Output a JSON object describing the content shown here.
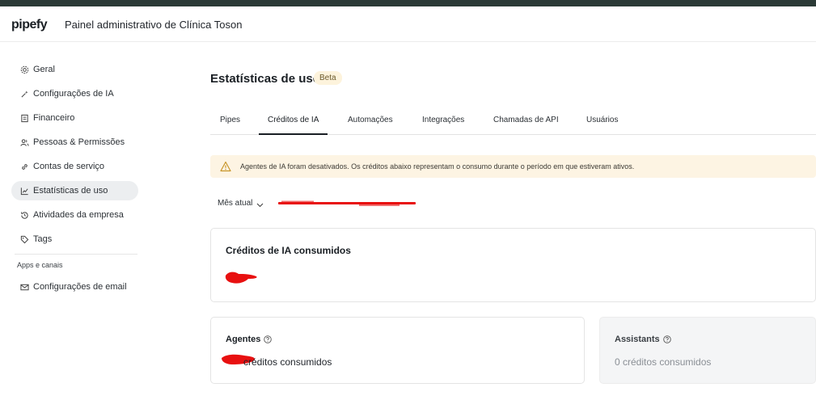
{
  "app": {
    "logo": "pipefy",
    "title": "Painel administrativo de Clínica Toson"
  },
  "sidebar": {
    "items": [
      {
        "label": "Geral",
        "icon": "gear-icon"
      },
      {
        "label": "Configurações de IA",
        "icon": "sparkle-icon"
      },
      {
        "label": "Financeiro",
        "icon": "invoice-icon"
      },
      {
        "label": "Pessoas & Permissões",
        "icon": "people-icon"
      },
      {
        "label": "Contas de serviço",
        "icon": "link-icon"
      },
      {
        "label": "Estatísticas de uso",
        "icon": "chart-icon",
        "active": true
      },
      {
        "label": "Atividades da empresa",
        "icon": "history-icon"
      },
      {
        "label": "Tags",
        "icon": "tag-icon"
      }
    ],
    "section_title": "Apps e canais",
    "section_items": [
      {
        "label": "Configurações de email",
        "icon": "mail-icon"
      }
    ]
  },
  "page": {
    "title": "Estatísticas de uso",
    "badge": "Beta"
  },
  "tabs": [
    {
      "label": "Pipes"
    },
    {
      "label": "Créditos de IA",
      "active": true
    },
    {
      "label": "Automações"
    },
    {
      "label": "Integrações"
    },
    {
      "label": "Chamadas de API"
    },
    {
      "label": "Usuários"
    }
  ],
  "alert": {
    "text": "Agentes de IA foram desativados. Os créditos abaixo representam o consumo durante o período em que estiveram ativos.",
    "icon": "warning-icon"
  },
  "filter": {
    "label": "Mês atual"
  },
  "cards": {
    "total": {
      "title": "Créditos de IA consumidos"
    },
    "agents": {
      "label": "Agentes",
      "value": "créditos consumidos"
    },
    "assistants": {
      "label": "Assistants",
      "value": "0 créditos consumidos"
    }
  },
  "colors": {
    "accent": "#1a1f24",
    "alert_bg": "#fdf4e3",
    "badge_bg": "#fdf3dc",
    "redaction": "#e81010"
  }
}
